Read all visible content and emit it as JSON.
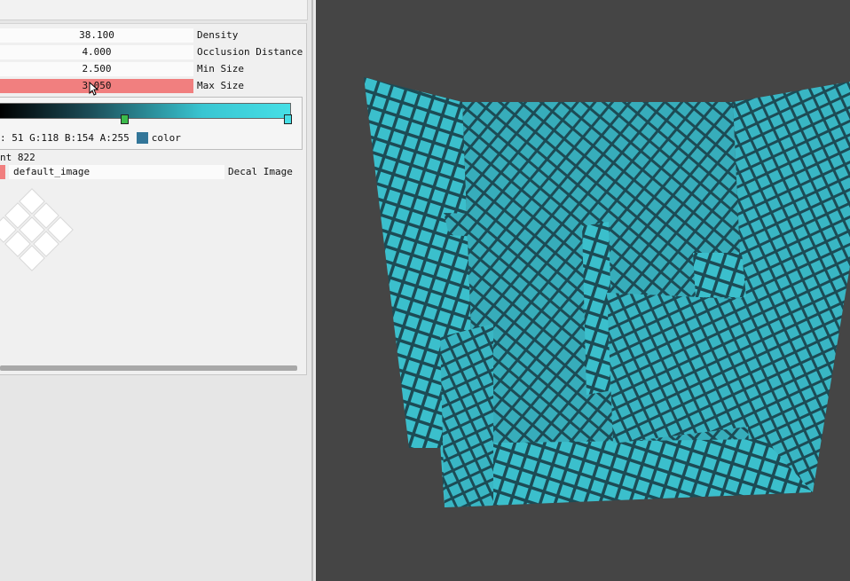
{
  "inspector": {
    "properties": [
      {
        "value": "38.100",
        "label": "Density"
      },
      {
        "value": "4.000",
        "label": "Occlusion Distance"
      },
      {
        "value": "2.500",
        "label": "Min Size"
      },
      {
        "value": "3.050",
        "label": "Max Size",
        "active": true
      }
    ],
    "color_stop": {
      "rgba_text": ": 51 G:118 B:154 A:255",
      "label": "color",
      "hex": "#337699"
    },
    "count_text": "nt 822",
    "decal_image": {
      "value": "default_image",
      "label": "Decal Image"
    }
  },
  "colors": {
    "active_field": "#f17f7f",
    "mesh_fill": "#3bbfcc",
    "viewport_bg": "#454545"
  },
  "icons": {
    "cursor": "arrow-cursor-icon",
    "preview": "decal-squares-preview"
  }
}
